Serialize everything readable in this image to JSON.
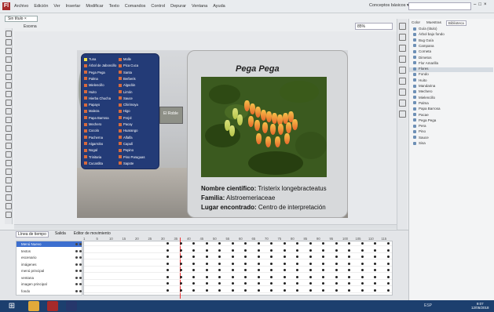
{
  "app": {
    "logo": "Fl",
    "menus": [
      "Archivo",
      "Edición",
      "Ver",
      "Insertar",
      "Modificar",
      "Texto",
      "Comandos",
      "Control",
      "Depurar",
      "Ventana",
      "Ayuda"
    ],
    "workspace": "Conceptos básicos ▾"
  },
  "document": {
    "tab": "Sin título ×",
    "breadcrumb": "Escena",
    "zoom": "85%"
  },
  "menu_panel": {
    "col1": [
      "Tuna",
      "Árbol de Jaboncillo",
      "Pega Pega",
      "Palma",
      "Mielencillo",
      "Huito",
      "Hierba Chucha",
      "Papayo",
      "Maleza",
      "Papa Barrosa",
      "Mechero",
      "Cocolo",
      "Pacherna",
      "Algarrobo",
      "Nogal",
      "Trinitaria",
      "Cucardita"
    ],
    "col2": [
      "Molle",
      "Pica Cuca",
      "Santa",
      "Berberis",
      "Algodón",
      "Limón",
      "Sauce",
      "Chirimoya",
      "Higo",
      "Frejol",
      "Pacay",
      "Huarango",
      "Alfalfa",
      "Capulí",
      "Pepino",
      "Pino Paraguas",
      "Sapote"
    ]
  },
  "card": {
    "title": "Pega Pega",
    "sci_label": "Nombre científico:",
    "sci_value": "Tristerix longebracteatus",
    "fam_label": "Familia:",
    "fam_value": "Alstroemeriaceae",
    "loc_label": "Lugar encontrado:",
    "loc_value": "Centro de interpretación",
    "bldg": "El Roble"
  },
  "library": {
    "tabs": [
      "Color",
      "Muestras",
      "Biblioteca"
    ],
    "items": [
      "Guía (titulo)",
      "Árbol bajo fondo",
      "Bug Guía",
      "Campana",
      "Corneta",
      "Dimetos",
      "Flor Amarilla",
      "Flores",
      "Fondo",
      "Huito",
      "Mandarina",
      "Mechero",
      "Mielencillo",
      "Palma",
      "Papa Barrosa",
      "Pacae",
      "Pega Pega",
      "Pera",
      "Pino",
      "Sauce",
      "Sisa"
    ]
  },
  "timeline": {
    "tabs": [
      "Línea de tiempo",
      "Salida",
      "Editor de movimiento"
    ],
    "ruler": [
      "1",
      "5",
      "10",
      "15",
      "20",
      "25",
      "30",
      "35",
      "40",
      "45",
      "50",
      "55",
      "60",
      "65",
      "70",
      "75",
      "80",
      "85",
      "90",
      "95",
      "100",
      "105",
      "110",
      "115"
    ],
    "layers": [
      "Menú Nuevo",
      "textos",
      "escenario",
      "imágenes",
      "menú principal",
      "ventana",
      "imagen principal",
      "fondo"
    ]
  },
  "taskbar": {
    "time": "9:07",
    "date": "12/05/2018",
    "tray": "ESP"
  },
  "colors": {
    "menu_panel": "#233b77",
    "accent": "#d86a3c"
  }
}
